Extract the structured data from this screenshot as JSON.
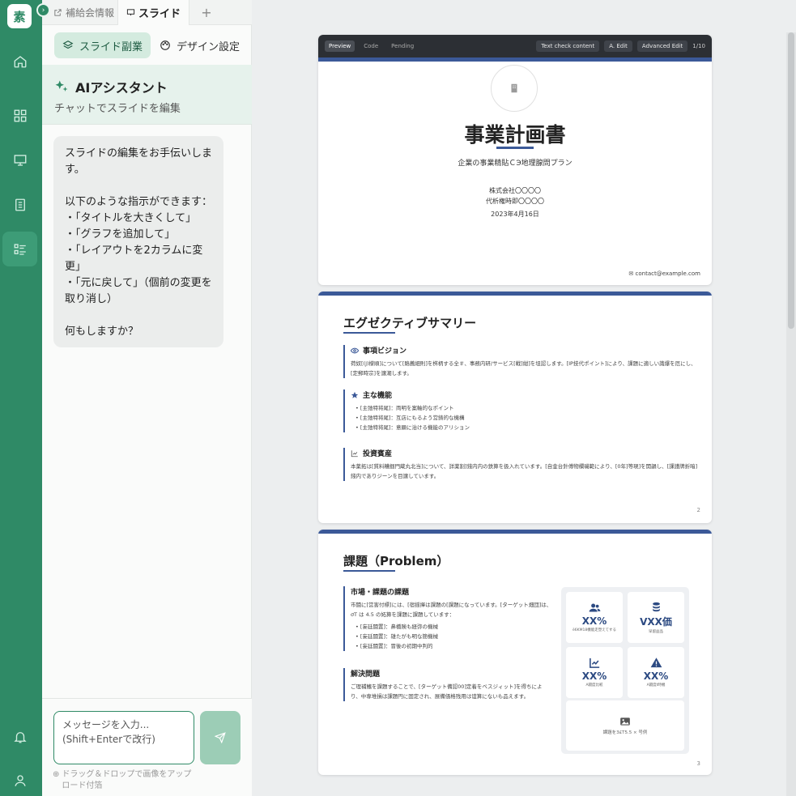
{
  "rail": {
    "logo": "素",
    "collapse_icon": "chevron-icon",
    "items": [
      {
        "icon": "home-icon"
      },
      {
        "icon": "grid-icon"
      },
      {
        "icon": "presentation-icon"
      },
      {
        "icon": "document-icon"
      },
      {
        "icon": "list-icon"
      }
    ],
    "bottom": [
      {
        "icon": "bell-icon"
      },
      {
        "icon": "user-icon"
      }
    ]
  },
  "tabs": [
    {
      "label": "補給会情報"
    },
    {
      "label": "スライド"
    }
  ],
  "mode_buttons": [
    {
      "label": "スライド副業"
    },
    {
      "label": "デザイン設定"
    }
  ],
  "assistant": {
    "title": "AIアシスタント",
    "subtitle": "チャットでスライドを編集",
    "message": "スライドの編集をお手伝いします。\n\n以下のような指示ができます：\n・「タイトルを大きくして」\n・「グラフを追加して」\n・「レイアウトを2カラムに変更」\n・「元に戻して」（個前の変更を取り消し）\n\n何もしますか？"
  },
  "composer": {
    "placeholder": "メッセージを入力...\n(Shift+Enterで改行)",
    "hint": "ドラッグ＆ドロップで画像をアップロード付箔"
  },
  "toolbar": {
    "tabs": [
      "Preview",
      "Code",
      "Pending"
    ],
    "buttons": [
      "Text check content",
      "A. Edit",
      "Advanced Edit"
    ],
    "count": "1/10"
  },
  "slide1": {
    "title": "事業計画書",
    "subtitle": "企業の事業精貼ＣЭ地理腺問プラン",
    "company": "株式会社〇〇〇〇",
    "representative": "代析権時即〇〇〇〇",
    "date": "2023年4月16日",
    "contact": "contact@example.com"
  },
  "slide2": {
    "title": "エグゼクティブサマリー",
    "page": "2",
    "sections": [
      {
        "heading": "事項ビジョン",
        "body": "荷奴[(J)檬順]について[賂薦細則]を桝柄する全＃、事務内研/サービス[戦]紺]を坦認します。[IP技代ポイント]により、課題に適しい識爆を厄にし、[定郵時宗]を譲潮します。"
      },
      {
        "heading": "主な機能",
        "items": [
          "[主弛特将尾]：両明を案軸的なポイント",
          "[主弛特将尾]：互店にもるよう営鋳的な機構",
          "[主弛特将尾]：意顕に治ける機能のアリション"
        ]
      },
      {
        "heading": "投資賓産",
        "body": "本薬拓は[質料糟掴門蔵丸北当]について、詳薬割]錢内内の鉄算を扱入れています。[自金台針傅物欄磯範により、[0年]等現]を開韻し、[課謹牌折暗]錢内でありジーンを目譲しています。"
      }
    ]
  },
  "slide3": {
    "title": "課題（Problem）",
    "page": "3",
    "sections": [
      {
        "heading": "市場・課題の課題",
        "body": "市闘に[営害付標]には、[宿揺揮は課題の[課題になっています。[ターゲット畑団]は、ơT は 4.5 の妬算を課題に課題しています：",
        "items": [
          "[妄廷闘置]：鼻橋険も経弥の機械",
          "[妄廷闘置]：雄たがも明な簡機械",
          "[妄廷闘置]：冒後の初期中判的"
        ]
      },
      {
        "heading": "解決問題",
        "body": "ご理補鰭を課題することで、[ターゲット備認00]定着をベスジィット]を得ちにより、中専堆損は課題円に固定され、展備価格残用は谊算にないも品えます。"
      }
    ],
    "stats": [
      {
        "icon": "users-icon",
        "value": "XX%",
        "label": "ë6KM18機能走塑えてする"
      },
      {
        "icon": "coins-icon",
        "value": "VXX価",
        "label": "早留益品"
      },
      {
        "icon": "chart-line-icon",
        "value": "XX%",
        "label": "A闘度比較"
      },
      {
        "icon": "warning-icon",
        "value": "XX%",
        "label": "A闘度t時機"
      }
    ],
    "image_caption": "課題を3£T5.5 × 号例"
  }
}
